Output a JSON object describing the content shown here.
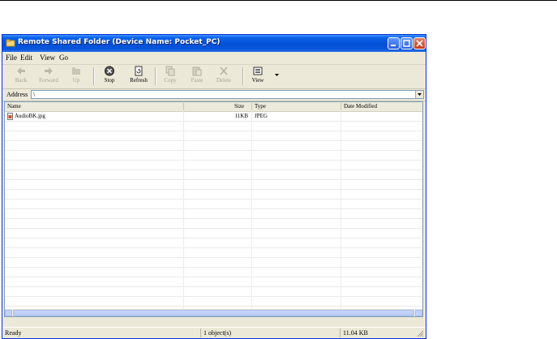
{
  "window": {
    "title": "Remote Shared Folder (Device Name: Pocket_PC)"
  },
  "menu": [
    "File",
    "Edit",
    "View",
    "Go"
  ],
  "toolbar": {
    "back": "Back",
    "forward": "Forward",
    "up": "Up",
    "stop": "Stop",
    "refresh": "Refresh",
    "copy": "Copy",
    "paste": "Paste",
    "delete": "Delete",
    "view": "View"
  },
  "address": {
    "label": "Address",
    "value": "\\"
  },
  "columns": {
    "name": "Name",
    "size": "Size",
    "type": "Type",
    "date": "Date Modified"
  },
  "files": [
    {
      "name": "AudioBK.jpg",
      "size": "11KB",
      "type": "JPEG",
      "date": ""
    }
  ],
  "status": {
    "left": "Ready",
    "middle": "1 object(s)",
    "right": "11.04 KB"
  },
  "colors": {
    "title_bar": "#0351d6",
    "window_bg": "#ece9d8",
    "close_button": "#c5391a"
  }
}
